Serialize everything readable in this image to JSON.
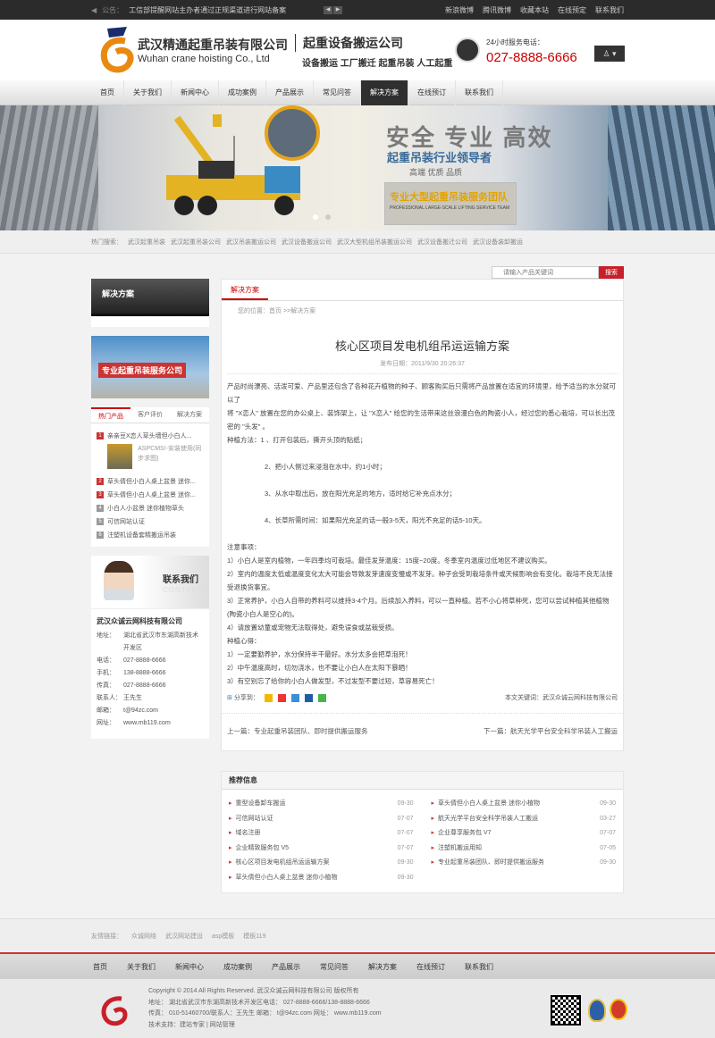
{
  "topbar": {
    "notice_label": "公告：",
    "notice_text": "工信部提醒网站主办者通过正规渠道进行网站备案",
    "links": [
      "新浪微博",
      "腾讯微博",
      "收藏本站",
      "在线预定",
      "联系我们"
    ]
  },
  "header": {
    "company_cn": "武汉精通起重吊装有限公司",
    "company_en": "Wuhan crane hoisting Co., Ltd",
    "slogan_title": "起重设备搬运公司",
    "slogan_sub": "设备搬运 工厂搬迁 起重吊装 人工起重",
    "phone_label": "24小时服务电话：",
    "phone_number": "027-8888-6666"
  },
  "nav": [
    "首页",
    "关于我们",
    "新闻中心",
    "成功案例",
    "产品展示",
    "常见问答",
    "解决方案",
    "在线预订",
    "联系我们"
  ],
  "nav_active": "解决方案",
  "banner": {
    "title": "安全 专业 高效",
    "sub": "起重吊装行业领导者",
    "sub2": "高端 优质 品质",
    "box1": "专业大型起重吊装服务团队",
    "box2": "PROFESSIONAL LARGE-SCALE LIFTING SERVICE TEAM"
  },
  "hotsearch": {
    "label": "热门搜索：",
    "items": [
      "武汉起重吊装",
      "武汉起重吊装公司",
      "武汉吊装搬运公司",
      "武汉设备搬运公司",
      "武汉大型机组吊装搬运公司",
      "武汉设备搬迁公司",
      "武汉设备装卸搬运"
    ]
  },
  "search": {
    "placeholder": "请输入产品关键词",
    "button": "搜索"
  },
  "sidebar": {
    "heading": "解决方案",
    "promo": "专业起重吊装服务公司",
    "tabs": [
      "热门产品",
      "客户评价",
      "解决方案"
    ],
    "hot": [
      {
        "n": "1",
        "t": "亲亲豆X恋人草头墙但小白人..."
      },
      {
        "n": "2",
        "t": "草头倩但小白人桌上盆景 迷你..."
      },
      {
        "n": "3",
        "t": "草头倩但小白人桌上盆景 迷你..."
      },
      {
        "n": "4",
        "t": "小白人小盆景 迷你植物草头"
      },
      {
        "n": "5",
        "t": "可信网站认证"
      },
      {
        "n": "6",
        "t": "注塑机设备套精搬运吊装"
      }
    ],
    "hot_first_desc": "ASPCMS!-安装使用(同步求图)",
    "contact_h1": "联系我们",
    "contact_h2": "CONTACT",
    "contact_name": "武汉众诚云网科技有限公司",
    "contact_rows": [
      {
        "k": "地址：",
        "v": "湖北省武汉市东湖高新技术开发区"
      },
      {
        "k": "电话：",
        "v": "027-8888-6666"
      },
      {
        "k": "手机：",
        "v": "138-8888-6666"
      },
      {
        "k": "传真：",
        "v": "027-8888-6666"
      },
      {
        "k": "联系人：",
        "v": "王先生"
      },
      {
        "k": "邮箱：",
        "v": "t@94zc.com"
      },
      {
        "k": "网址：",
        "v": "www.mb119.com"
      }
    ]
  },
  "article": {
    "tab": "解决方案",
    "crumb": "您的位置：首页 >>解决方案",
    "title": "核心区项目发电机组吊运运输方案",
    "meta": "发布日期：2011/9/30 20:26:37",
    "body": [
      "产品时尚漂亮、活泼可爱、产品里还包含了各种花卉植物的种子、顾客购买后只需将产品放置在适宜的环境里，给予适当的水分就可以了",
      "将 \"X恋人\" 放置在您的办公桌上、装饰架上，让 \"X恋人\" 给您的生活带来这丝浪漫白色的陶瓷小人，经过您的悉心栽培，可以长出茂密的 \"头发\" 。",
      "种植方法：1 、打开包装后，撕开头顶的贴纸；",
      "",
      "2、把小人侧过来浸泡在水中，约1小时；",
      "",
      "3、从水中取出后，放在阳光充足的地方，适时给它补充点水分；",
      "",
      "4、长草所需时间：如果阳光充足的话一般3-5天，阳光不充足的话5-10天。",
      "",
      "注意事项：",
      "1）小白人是室内植物，一年四季均可栽培。最佳发芽温度：15度~20度。冬季室内温度过低地区不建议购买。",
      "2）室内的温度太低或温度变化太大可能会导致发芽速度变慢或不发芽。种子会受到栽培条件或天候影响会有变化。栽培不良无法接受退换货事宜。",
      "3）正常养护，小白人自带的养料可以维持3-4个月。后续加入养料，可以一直种植。若不小心将草种死，您可以尝试种植其他植物(陶瓷小白人是空心的)。",
      "4）请放置幼童或宠物无法取得处，避免误食或盆栽受损。",
      "种植心得：",
      "1）一定要勤养护，水分保持半干最好。水分太多会把草泡死！",
      "2）中午温度高时，切勿浇水，也不要让小白人在太阳下暴晒！",
      "3）有空别忘了给你的小白人做发型，不过发型不要过短，草容易死亡！"
    ],
    "share_label": "分享到：",
    "keyword": "本文关键词：武汉众诚云网科技有限公司",
    "prev": "上一篇：专业起重吊装团队、即时提供搬运服务",
    "next": "下一篇：航天光学平台安全科学吊装人工搬运"
  },
  "recommend": {
    "heading": "推荐信息",
    "items": [
      {
        "t": "重型设备卸车搬运",
        "d": "09-30"
      },
      {
        "t": "草头倩但小白人桌上盆景 迷你小植物",
        "d": "09-30"
      },
      {
        "t": "可信网站认证",
        "d": "07-07"
      },
      {
        "t": "航天光学平台安全科学吊装人工搬运",
        "d": "03-27"
      },
      {
        "t": "域名注册",
        "d": "07-07"
      },
      {
        "t": "企业尊享服务包 V7",
        "d": "07-07"
      },
      {
        "t": "企业精致服务包 V5",
        "d": "07-07"
      },
      {
        "t": "注塑机搬运用知",
        "d": "07-05"
      },
      {
        "t": "核心区项目发电机组吊运运输方案",
        "d": "09-30"
      },
      {
        "t": "专业起重吊装团队、即时提供搬运服务",
        "d": "09-30"
      },
      {
        "t": "草头倩但小白人桌上盆景 迷你小植物",
        "d": "09-30"
      }
    ]
  },
  "friendlinks": {
    "label": "友情链接：",
    "items": [
      "众诚网络",
      "武汉网站建设",
      "asp模板",
      "模板119"
    ]
  },
  "footer": {
    "lines": [
      "Copyright © 2014  All Rights Reserved. 武汉众诚云网科技有限公司 版权所有",
      "地址：  湖北省武汉市东湖高新技术开发区电话：  027-8888-6666/138-8888-6666",
      "传真：  010-51460700/联系人：王先生  邮箱：  t@94zc.com  网址：  www.mb119.com",
      "技术支持：建站专家 | 网站管理"
    ]
  },
  "colors": {
    "accent": "#c8202a",
    "nav_active": "#2f2f2f",
    "phone": "#cc0000"
  }
}
